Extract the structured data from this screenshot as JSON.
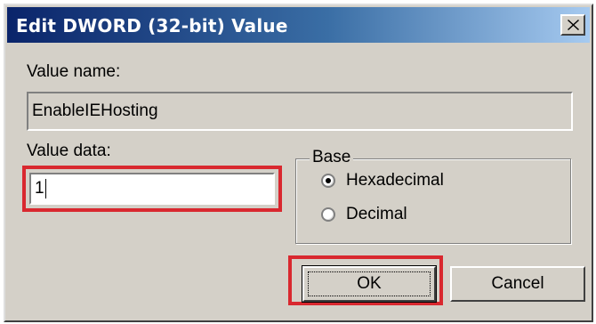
{
  "window": {
    "title": "Edit DWORD (32-bit) Value",
    "close_symbol": "close-icon"
  },
  "value_name": {
    "label": "Value name:",
    "value": "EnableIEHosting"
  },
  "value_data": {
    "label": "Value data:",
    "value": "1"
  },
  "base": {
    "legend": "Base",
    "options": [
      {
        "label": "Hexadecimal",
        "selected": true
      },
      {
        "label": "Decimal",
        "selected": false
      }
    ]
  },
  "buttons": {
    "ok_label": "OK",
    "cancel_label": "Cancel"
  },
  "colors": {
    "highlight": "#d9282f",
    "title_bar_start": "#0a246a",
    "title_bar_end": "#a6caf0",
    "dialog_face": "#d4d0c8"
  }
}
